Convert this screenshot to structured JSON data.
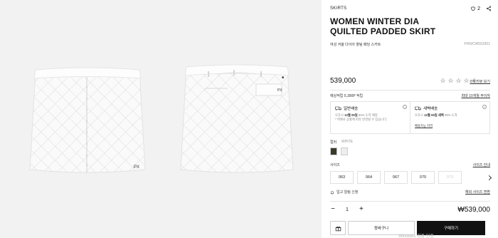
{
  "product": {
    "category": "SKIRTS",
    "title": "WOMEN WINTER DIA QUILTED PADDED SKIRT",
    "subtitle": "여성 겨울 다이아 퀼팅 패딩 스커트",
    "code": "PHWCW563301",
    "price": "539,000",
    "wish_count": "2",
    "review_link": "0개 리뷰 보기",
    "rating": 0
  },
  "benefits": {
    "points": "예상적립 5,390P 적립",
    "card_link": "최대 10개월 무이자"
  },
  "shipping": {
    "normal_title": "일반배송",
    "normal_desc_1": "오후시 ",
    "normal_bold": "12월 05일",
    "normal_desc_2": " 85% 도착 예정",
    "normal_desc_3": "* 택배사 상황에 따라 변경될 수 있습니다.",
    "dawn_title": "새벽배송",
    "dawn_desc_1": "오후시 ",
    "dawn_bold": "12월 05일 새벽",
    "dawn_desc_2": " 98% 도착",
    "dawn_link": "배송가능 지역"
  },
  "color": {
    "label": "컬러",
    "selected": "WHITE",
    "swatches": [
      "olive",
      "white"
    ]
  },
  "size": {
    "label": "사이즈",
    "guide": "사이즈 안내",
    "options": [
      "063",
      "064",
      "067",
      "070",
      "073"
    ],
    "disabled": [
      false,
      false,
      false,
      false,
      true
    ],
    "restock": "입고 알림 신청",
    "help": "해외 사이즈 변환"
  },
  "order": {
    "quantity": "1",
    "minus": "−",
    "plus": "+",
    "total": "₩539,000",
    "cart": "장바구니",
    "buy": "구매하기",
    "watermark": "Windows 정품 인증"
  },
  "colors": {
    "accent": "#111111",
    "gallery_bg": "#f2f2f2",
    "swatch_olive": "#3b3a2a",
    "swatch_white": "#eeeeee"
  }
}
